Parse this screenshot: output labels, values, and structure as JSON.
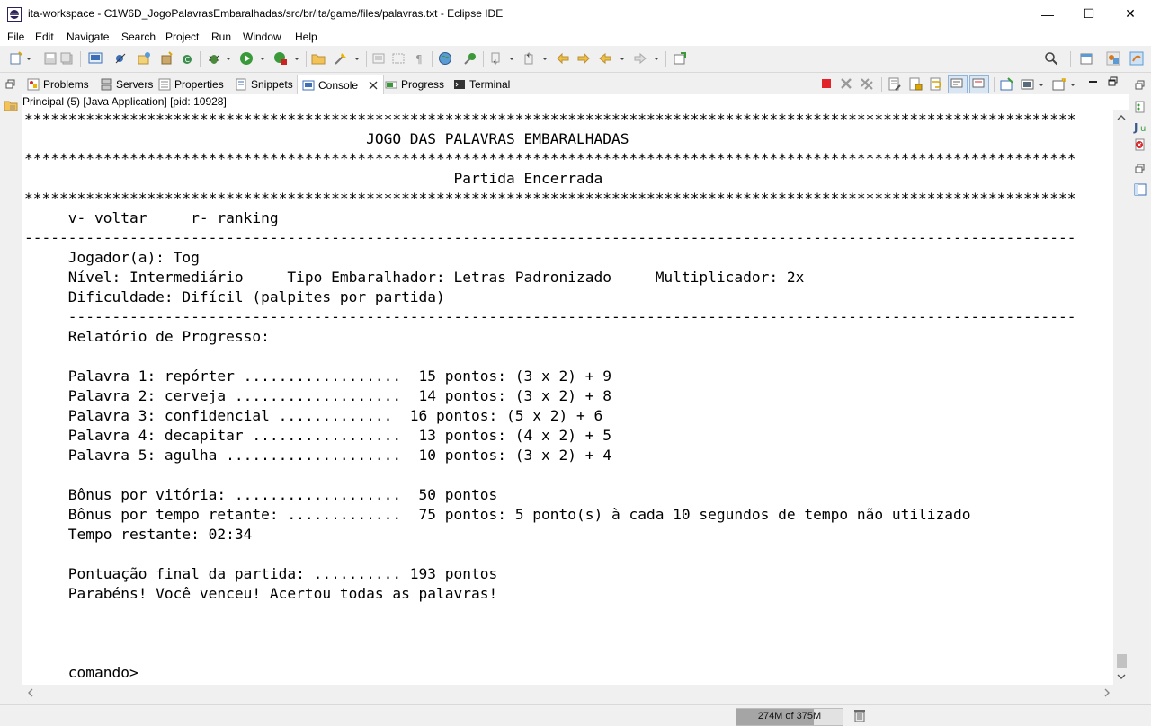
{
  "window": {
    "title": "ita-workspace - C1W6D_JogoPalavrasEmbaralhadas/src/br/ita/game/files/palavras.txt - Eclipse IDE",
    "minimize": "—",
    "maximize": "☐",
    "close": "✕"
  },
  "menu": [
    "File",
    "Edit",
    "Navigate",
    "Search",
    "Project",
    "Run",
    "Window",
    "Help"
  ],
  "tabs": [
    {
      "label": "Problems",
      "icon": "problems-icon"
    },
    {
      "label": "Servers",
      "icon": "servers-icon"
    },
    {
      "label": "Properties",
      "icon": "properties-icon"
    },
    {
      "label": "Snippets",
      "icon": "snippets-icon"
    },
    {
      "label": "Console",
      "icon": "console-icon",
      "active": true
    },
    {
      "label": "Progress",
      "icon": "progress-icon"
    },
    {
      "label": "Terminal",
      "icon": "terminal-icon"
    }
  ],
  "console_header": "Principal (5) [Java Application]  [pid: 10928]",
  "console_lines": [
    "************************************************************************************************************************",
    "                                       JOGO DAS PALAVRAS EMBARALHADAS",
    "************************************************************************************************************************",
    "                                                 Partida Encerrada",
    "************************************************************************************************************************",
    "     v- voltar     r- ranking",
    "------------------------------------------------------------------------------------------------------------------------",
    "     Jogador(a): Tog",
    "     Nível: Intermediário     Tipo Embaralhador: Letras Padronizado     Multiplicador: 2x",
    "     Dificuldade: Difícil (palpites por partida)",
    "     -------------------------------------------------------------------------------------------------------------------",
    "     Relatório de Progresso:",
    "",
    "     Palavra 1: repórter ..................  15 pontos: (3 x 2) + 9",
    "     Palavra 2: cerveja ...................  14 pontos: (3 x 2) + 8",
    "     Palavra 3: confidencial .............  16 pontos: (5 x 2) + 6",
    "     Palavra 4: decapitar .................  13 pontos: (4 x 2) + 5",
    "     Palavra 5: agulha ....................  10 pontos: (3 x 2) + 4",
    "",
    "     Bônus por vitória: ...................  50 pontos",
    "     Bônus por tempo retante: .............  75 pontos: 5 ponto(s) à cada 10 segundos de tempo não utilizado",
    "     Tempo restante: 02:34",
    "",
    "     Pontuação final da partida: .......... 193 pontos",
    "     Parabéns! Você venceu! Acertou todas as palavras!",
    "",
    "",
    "",
    "     comando>"
  ],
  "heap": {
    "label": "274M of 375M",
    "used_fraction": 0.73
  },
  "colors": {
    "terminate": "#e0242a",
    "accent": "#3c6fb6"
  }
}
